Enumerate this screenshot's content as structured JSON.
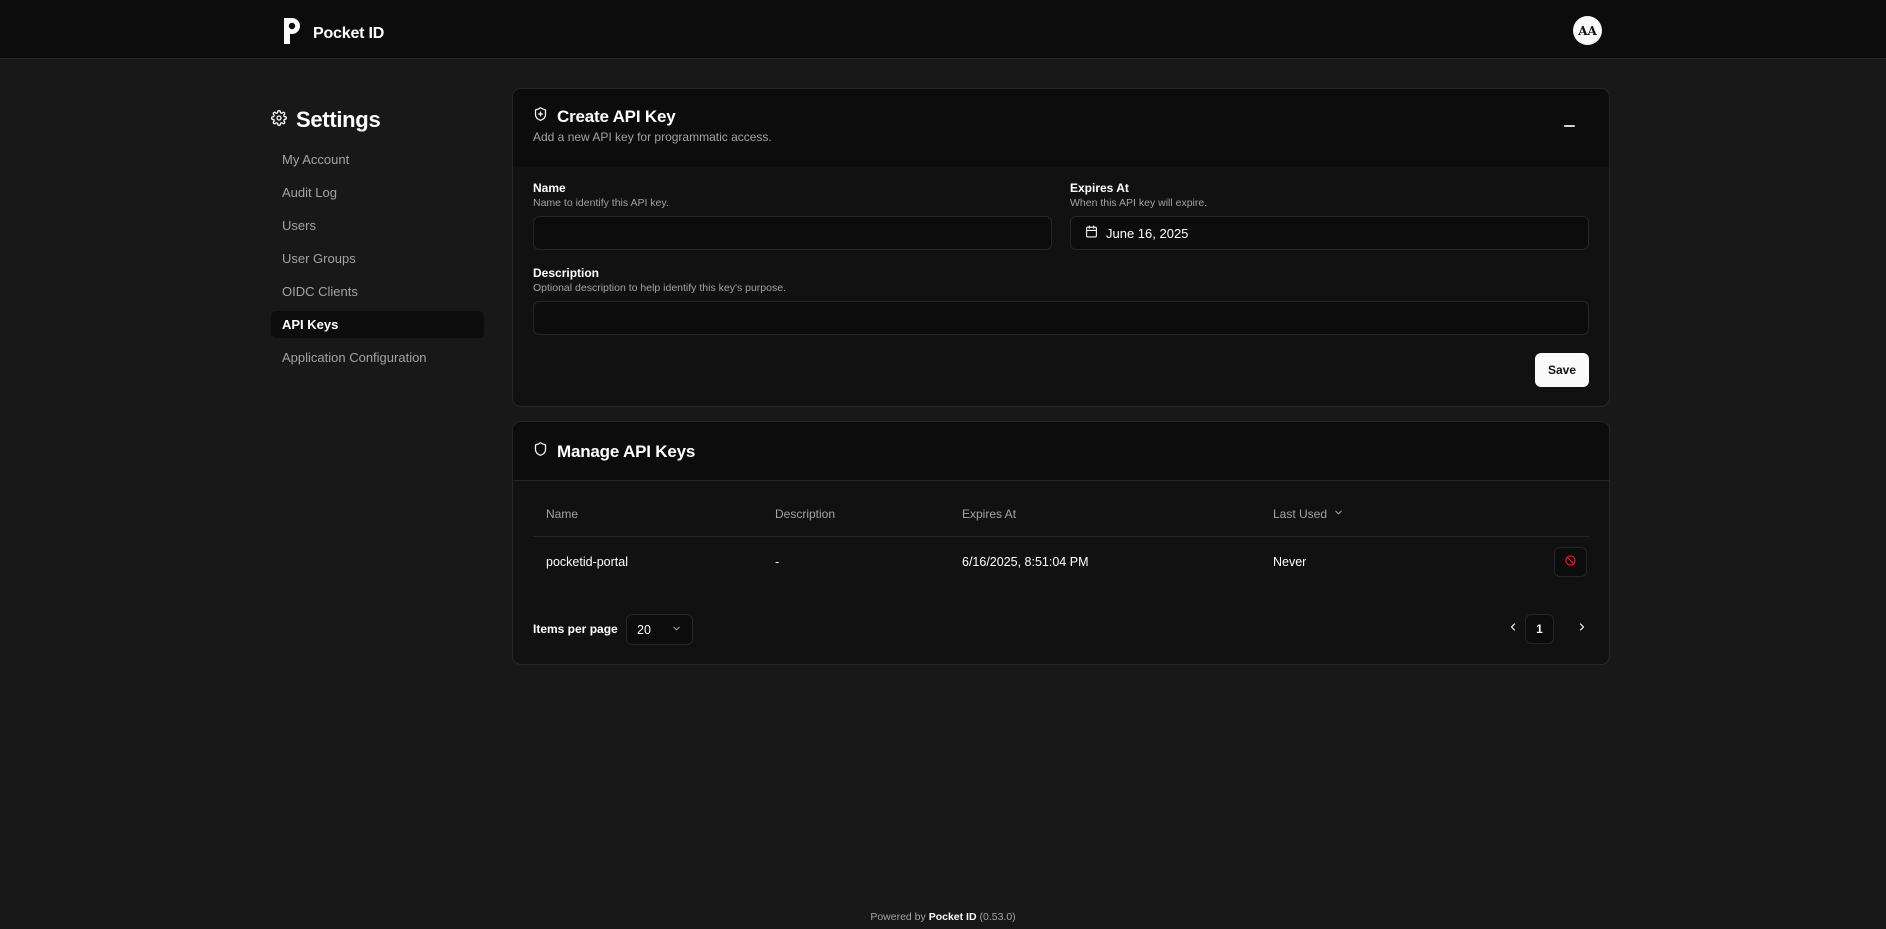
{
  "app": {
    "name": "Pocket ID",
    "avatar_initials": "AA"
  },
  "sidebar": {
    "title": "Settings",
    "items": [
      {
        "label": "My Account"
      },
      {
        "label": "Audit Log"
      },
      {
        "label": "Users"
      },
      {
        "label": "User Groups"
      },
      {
        "label": "OIDC Clients"
      },
      {
        "label": "API Keys",
        "active": true
      },
      {
        "label": "Application Configuration"
      }
    ]
  },
  "create_card": {
    "title": "Create API Key",
    "subtitle": "Add a new API key for programmatic access.",
    "name_label": "Name",
    "name_help": "Name to identify this API key.",
    "name_value": "",
    "expires_label": "Expires At",
    "expires_help": "When this API key will expire.",
    "expires_value": "June 16, 2025",
    "description_label": "Description",
    "description_help": "Optional description to help identify this key's purpose.",
    "description_value": "",
    "save_label": "Save"
  },
  "manage_card": {
    "title": "Manage API Keys",
    "columns": [
      "Name",
      "Description",
      "Expires At",
      "Last Used"
    ],
    "rows": [
      {
        "name": "pocketid-portal",
        "description": "-",
        "expires_at": "6/16/2025, 8:51:04 PM",
        "last_used": "Never"
      }
    ],
    "items_per_page_label": "Items per page",
    "items_per_page_value": "20",
    "current_page": "1"
  },
  "footer": {
    "prefix": "Powered by",
    "brand": "Pocket ID",
    "version": "(0.53.0)"
  },
  "colors": {
    "background": "#181818",
    "card": "#111111",
    "border": "#262626",
    "danger": "#dc2626",
    "primary_button": "#fafafa"
  },
  "icons": [
    "pocket-id-logo",
    "gear-icon",
    "shield-plus-icon",
    "minus-icon",
    "calendar-icon",
    "shield-icon",
    "chevron-down-icon",
    "ban-icon",
    "chevron-left-icon",
    "chevron-right-icon"
  ]
}
